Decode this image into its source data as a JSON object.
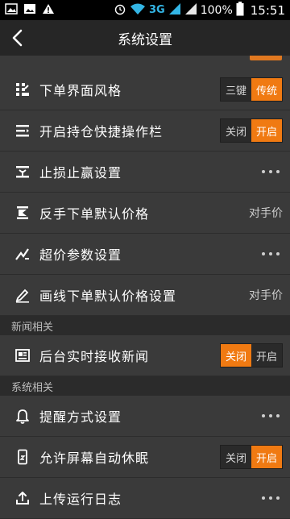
{
  "status_bar": {
    "network": "3G",
    "battery": "100%",
    "time": "15:51"
  },
  "header": {
    "title": "系统设置"
  },
  "sections": [
    {
      "title": "",
      "items": [
        {
          "label": "下单界面风格",
          "icon": "layout-icon",
          "control": "segmented",
          "options": [
            "三键",
            "传统"
          ],
          "selected": 1
        },
        {
          "label": "开启持仓快捷操作栏",
          "icon": "list-icon",
          "control": "segmented",
          "options": [
            "关闭",
            "开启"
          ],
          "selected": 1
        },
        {
          "label": "止损止赢设置",
          "icon": "stop-profit-icon",
          "control": "more"
        },
        {
          "label": "反手下单默认价格",
          "icon": "reverse-order-icon",
          "control": "value",
          "value": "对手价"
        },
        {
          "label": "超价参数设置",
          "icon": "trend-icon",
          "control": "more"
        },
        {
          "label": "画线下单默认价格设置",
          "icon": "pencil-icon",
          "control": "value",
          "value": "对手价"
        }
      ]
    },
    {
      "title": "新闻相关",
      "items": [
        {
          "label": "后台实时接收新闻",
          "icon": "news-icon",
          "control": "segmented",
          "options": [
            "关闭",
            "开启"
          ],
          "selected": 0
        }
      ]
    },
    {
      "title": "系统相关",
      "items": [
        {
          "label": "提醒方式设置",
          "icon": "bell-icon",
          "control": "more"
        },
        {
          "label": "允许屏幕自动休眠",
          "icon": "phone-icon",
          "control": "segmented",
          "options": [
            "关闭",
            "开启"
          ],
          "selected": 1
        },
        {
          "label": "上传运行日志",
          "icon": "upload-icon",
          "control": "more"
        }
      ]
    }
  ],
  "colors": {
    "accent": "#f07a12",
    "background": "#3a3a3a",
    "header": "#262626",
    "section": "#2b2b2b"
  }
}
